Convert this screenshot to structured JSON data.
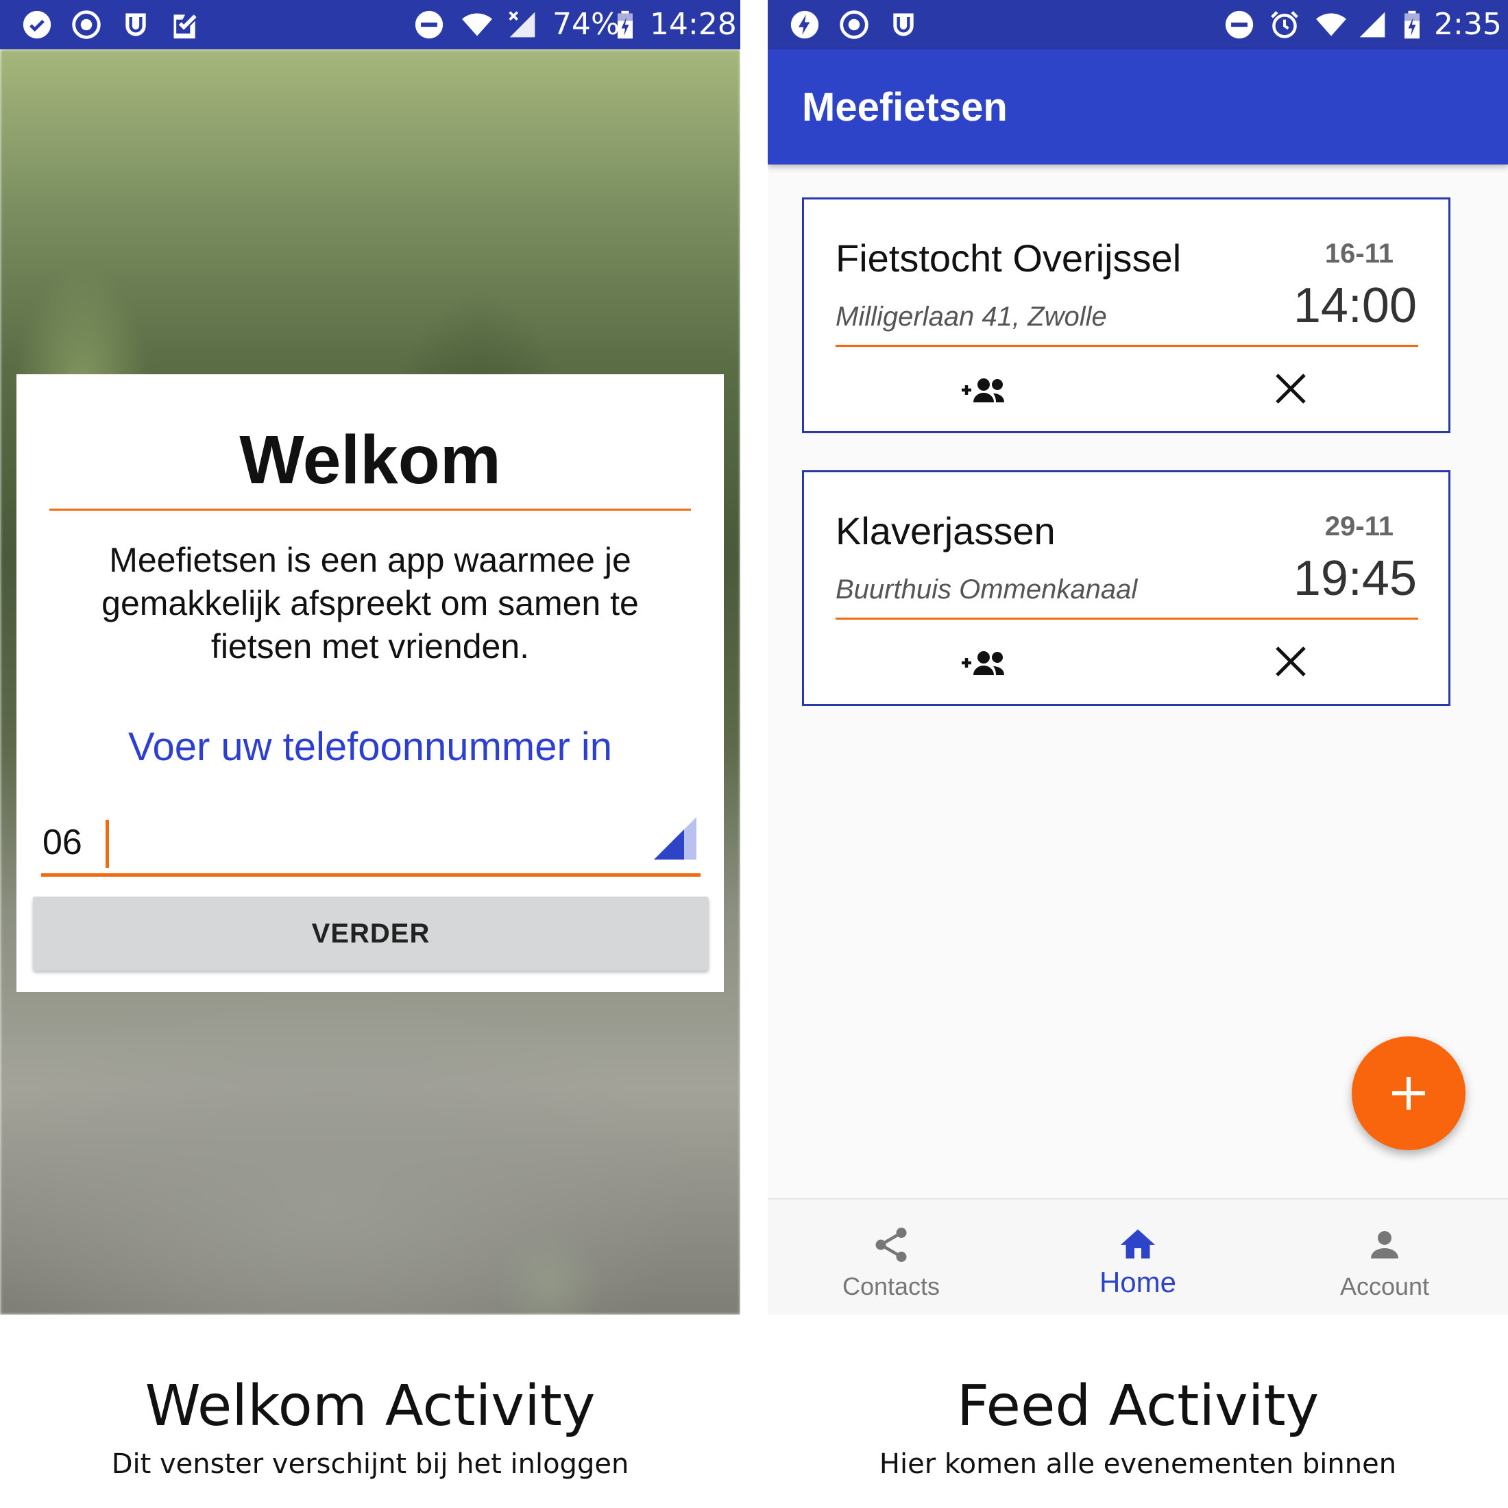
{
  "welkom_screen": {
    "status_bar": {
      "battery": "74%",
      "time": "14:28"
    },
    "title": "Welkom",
    "description": "Meefietsen is een app waarmee je gemakkelijk afspreekt om samen te fietsen met vrienden.",
    "phone_prompt": "Voer uw telefoonnummer in",
    "phone_input_value": "06",
    "continue_button": "VERDER",
    "caption_title": "Welkom Activity",
    "caption_subtitle": "Dit venster verschijnt bij het inloggen"
  },
  "feed_screen": {
    "status_bar": {
      "time": "2:35"
    },
    "app_title": "Meefietsen",
    "events": [
      {
        "name": "Fietstocht Overijssel",
        "location": "Milligerlaan 41, Zwolle",
        "date": "16-11",
        "time": "14:00"
      },
      {
        "name": "Klaverjassen",
        "location": "Buurthuis Ommenkanaal",
        "date": "29-11",
        "time": "19:45"
      }
    ],
    "fab_icon": "plus-icon",
    "bottom_nav": [
      {
        "label": "Contacts",
        "icon": "share-icon",
        "active": false
      },
      {
        "label": "Home",
        "icon": "home-icon",
        "active": true
      },
      {
        "label": "Account",
        "icon": "person-icon",
        "active": false
      }
    ],
    "caption_title": "Feed Activity",
    "caption_subtitle": "Hier komen alle evenementen binnen"
  },
  "colors": {
    "primary": "#2e44c8",
    "status_bar": "#2a39a8",
    "accent": "#f8650c",
    "rule": "#f26b0e",
    "prompt_text": "#2c3fd0"
  }
}
